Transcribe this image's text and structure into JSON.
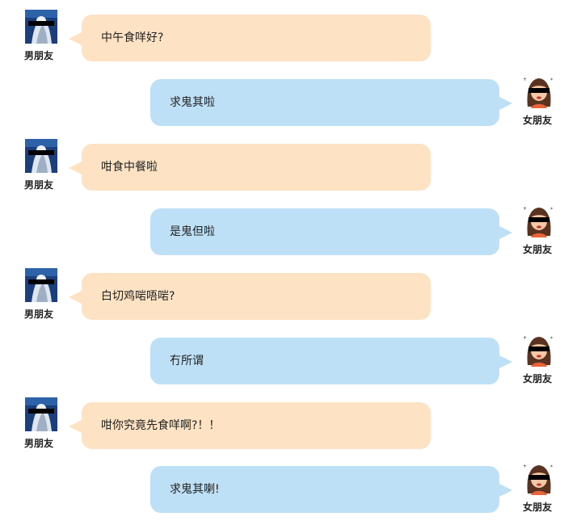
{
  "participants": {
    "boyfriend": {
      "name": "男朋友",
      "avatar_icon": "boyfriend-avatar-icon",
      "bubble_color": "#fde3c3"
    },
    "girlfriend": {
      "name": "女朋友",
      "avatar_icon": "girlfriend-avatar-icon",
      "bubble_color": "#bee0f7"
    }
  },
  "messages": [
    {
      "sender": "boyfriend",
      "sender_name": "男朋友",
      "text": "中午食咩好?"
    },
    {
      "sender": "girlfriend",
      "sender_name": "女朋友",
      "text": "求鬼其啦"
    },
    {
      "sender": "boyfriend",
      "sender_name": "男朋友",
      "text": "咁食中餐啦"
    },
    {
      "sender": "girlfriend",
      "sender_name": "女朋友",
      "text": "是鬼但啦"
    },
    {
      "sender": "boyfriend",
      "sender_name": "男朋友",
      "text": "白切鸡啱唔啱?"
    },
    {
      "sender": "girlfriend",
      "sender_name": "女朋友",
      "text": "冇所谓"
    },
    {
      "sender": "boyfriend",
      "sender_name": "男朋友",
      "text": "咁你究竟先食咩啊?！！"
    },
    {
      "sender": "girlfriend",
      "sender_name": "女朋友",
      "text": "求鬼其喇!"
    }
  ]
}
